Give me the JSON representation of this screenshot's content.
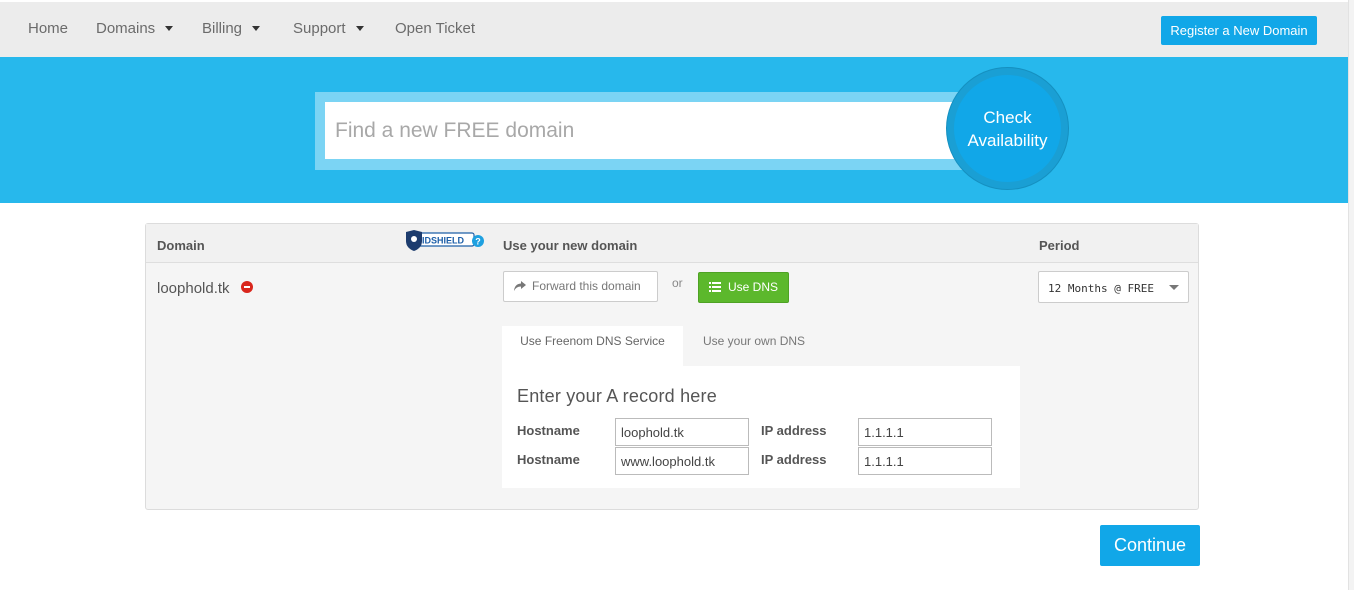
{
  "nav": {
    "items": [
      {
        "label": "Home",
        "has_caret": false
      },
      {
        "label": "Domains",
        "has_caret": true
      },
      {
        "label": "Billing",
        "has_caret": true
      },
      {
        "label": "Support",
        "has_caret": true
      },
      {
        "label": "Open Ticket",
        "has_caret": false
      }
    ],
    "register_button": "Register a New Domain"
  },
  "hero": {
    "search_placeholder": "Find a new FREE domain",
    "check_line1": "Check",
    "check_line2": "Availability"
  },
  "table": {
    "headers": {
      "domain": "Domain",
      "use_new_domain": "Use your new domain",
      "period": "Period"
    },
    "idshield_logo": "IDSHIELD",
    "domain_name": "loophold.tk",
    "forward_button": "Forward this domain",
    "or_text": "or",
    "use_dns_button": "Use DNS",
    "period_value": "12 Months @ FREE",
    "tabs": [
      "Use Freenom DNS Service",
      "Use your own DNS"
    ],
    "dns_title": "Enter your A record here",
    "records": [
      {
        "hostname_label": "Hostname",
        "hostname": "loophold.tk",
        "ip_label": "IP address",
        "ip": "1.1.1.1"
      },
      {
        "hostname_label": "Hostname",
        "hostname": "www.loophold.tk",
        "ip_label": "IP address",
        "ip": "1.1.1.1"
      }
    ]
  },
  "continue_button": "Continue",
  "colors": {
    "brand_blue": "#11a7e8",
    "hero_bg": "#27b8ec",
    "dns_green": "#5cb82c",
    "remove_red": "#d9261c"
  }
}
